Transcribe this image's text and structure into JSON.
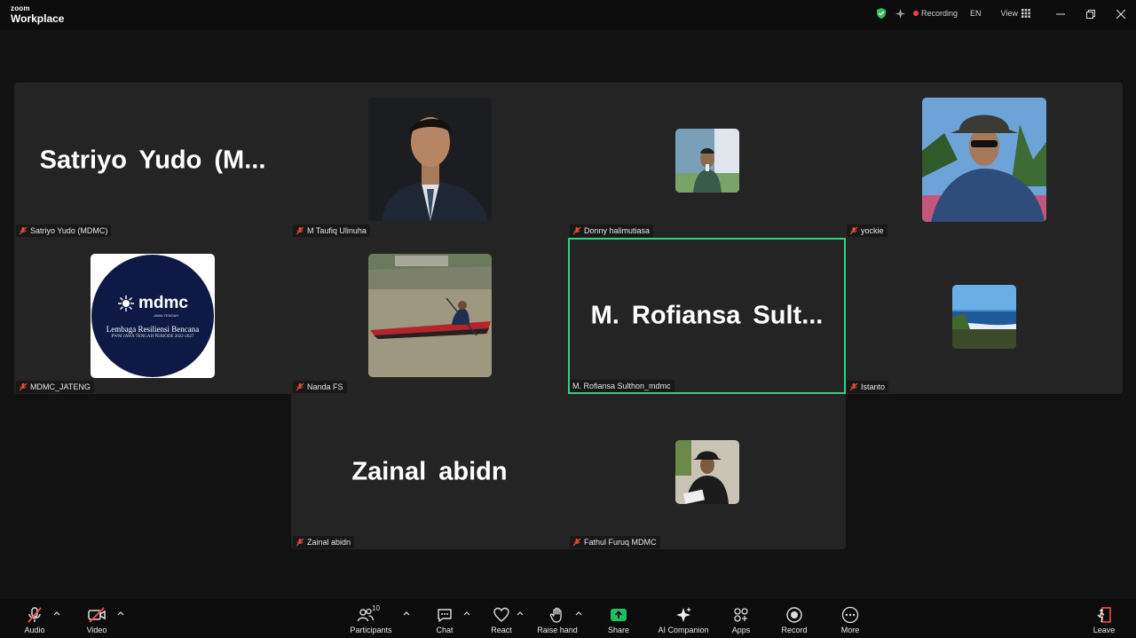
{
  "app": {
    "brand_small": "zoom",
    "brand_main": "Workplace"
  },
  "titlebar": {
    "recording_label": "Recording",
    "language": "EN",
    "view_label": "View"
  },
  "tiles": [
    {
      "name": "Satriyo Yudo (MDMC)",
      "display": "Satriyo  Yudo  (M...",
      "video": false
    },
    {
      "name": "M Taufiq Ulinuha",
      "video": true
    },
    {
      "name": "Donny halimutiasa",
      "video": true
    },
    {
      "name": "yockie",
      "video": true
    },
    {
      "name": "MDMC_JATENG",
      "video": true,
      "logo": {
        "brand": "mdmc",
        "tag": "JAWA TENGAH",
        "line1": "Lembaga Resiliensi Bencana",
        "line2": "PWM JAWA TENGAH PERIODE 2022-2027"
      }
    },
    {
      "name": "Nanda FS",
      "video": true
    },
    {
      "name": "M. Rofiansa Sulthon_mdmc",
      "display": "M.  Rofiansa  Sult...",
      "video": false,
      "active": true
    },
    {
      "name": "Istanto",
      "video": true
    },
    {
      "name": "Zainal abidn",
      "display": "Zainal abidn",
      "video": false
    },
    {
      "name": "Fathul Furuq MDMC",
      "video": true
    }
  ],
  "toolbar": {
    "audio": "Audio",
    "video": "Video",
    "participants": "Participants",
    "participants_count": "10",
    "chat": "Chat",
    "react": "React",
    "raise_hand": "Raise hand",
    "share": "Share",
    "ai_companion": "AI Companion",
    "apps": "Apps",
    "record": "Record",
    "more": "More",
    "leave": "Leave"
  },
  "colors": {
    "active_speaker": "#2fd187",
    "share_green": "#1fbf5f",
    "leave_red": "#ff4d4d",
    "background": "#121212",
    "tile_bg": "#242424"
  }
}
